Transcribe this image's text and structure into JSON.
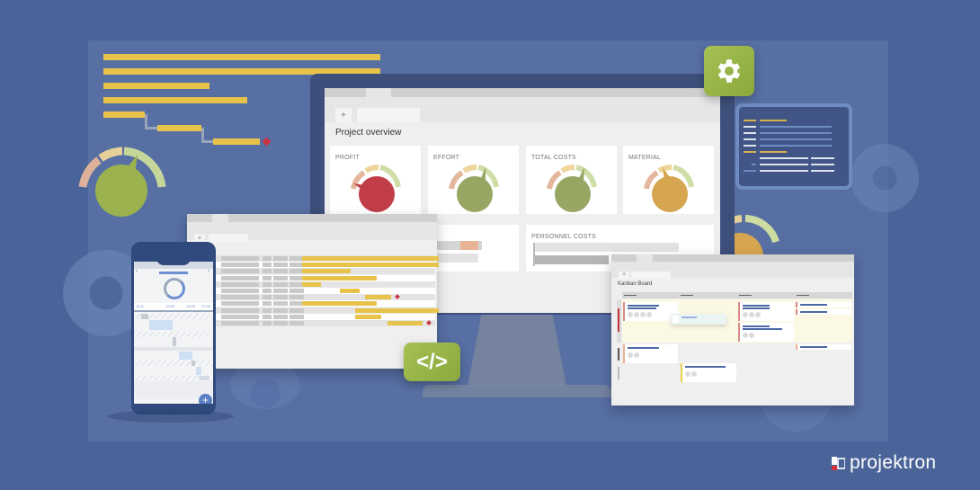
{
  "brand": {
    "name": "projektron",
    "logo_icon": "projektron-logo-icon",
    "colors": {
      "background": "#4a6399",
      "accent_green": "#9bb648",
      "gantt_yellow": "#e8c34c",
      "milestone_red": "#c8333f"
    }
  },
  "monitor": {
    "new_tab_label": "+",
    "page_title": "Project overview",
    "kpi_cards": [
      {
        "label": "PROFIT",
        "status": "red",
        "color": "#c13e48",
        "gauge_value": 0.12
      },
      {
        "label": "EFFORT",
        "status": "green",
        "color": "#97a663",
        "gauge_value": 0.58
      },
      {
        "label": "TOTAL COSTS",
        "status": "green",
        "color": "#97a663",
        "gauge_value": 0.6
      },
      {
        "label": "MATERIAL",
        "status": "amber",
        "color": "#d6a550",
        "gauge_value": 0.35
      }
    ],
    "personnel_costs": {
      "label": "PERSONNEL COSTS",
      "bar1": 0.95,
      "bar2": 0.55
    }
  },
  "gantt_window": {
    "new_tab_label": "+",
    "row_count": 11
  },
  "phone": {
    "time_labels": [
      "8:00",
      "12:00",
      "15:00",
      "17:00"
    ],
    "prev_icon": "chevron-left-icon",
    "next_icon": "chevron-right-icon",
    "add_icon": "plus-icon",
    "add_label": "+"
  },
  "kanban": {
    "new_tab_label": "+",
    "title": "Kanban Board"
  },
  "badges": {
    "settings_icon": "gear-icon",
    "code_icon": "code-icon",
    "code_label": "</>"
  }
}
